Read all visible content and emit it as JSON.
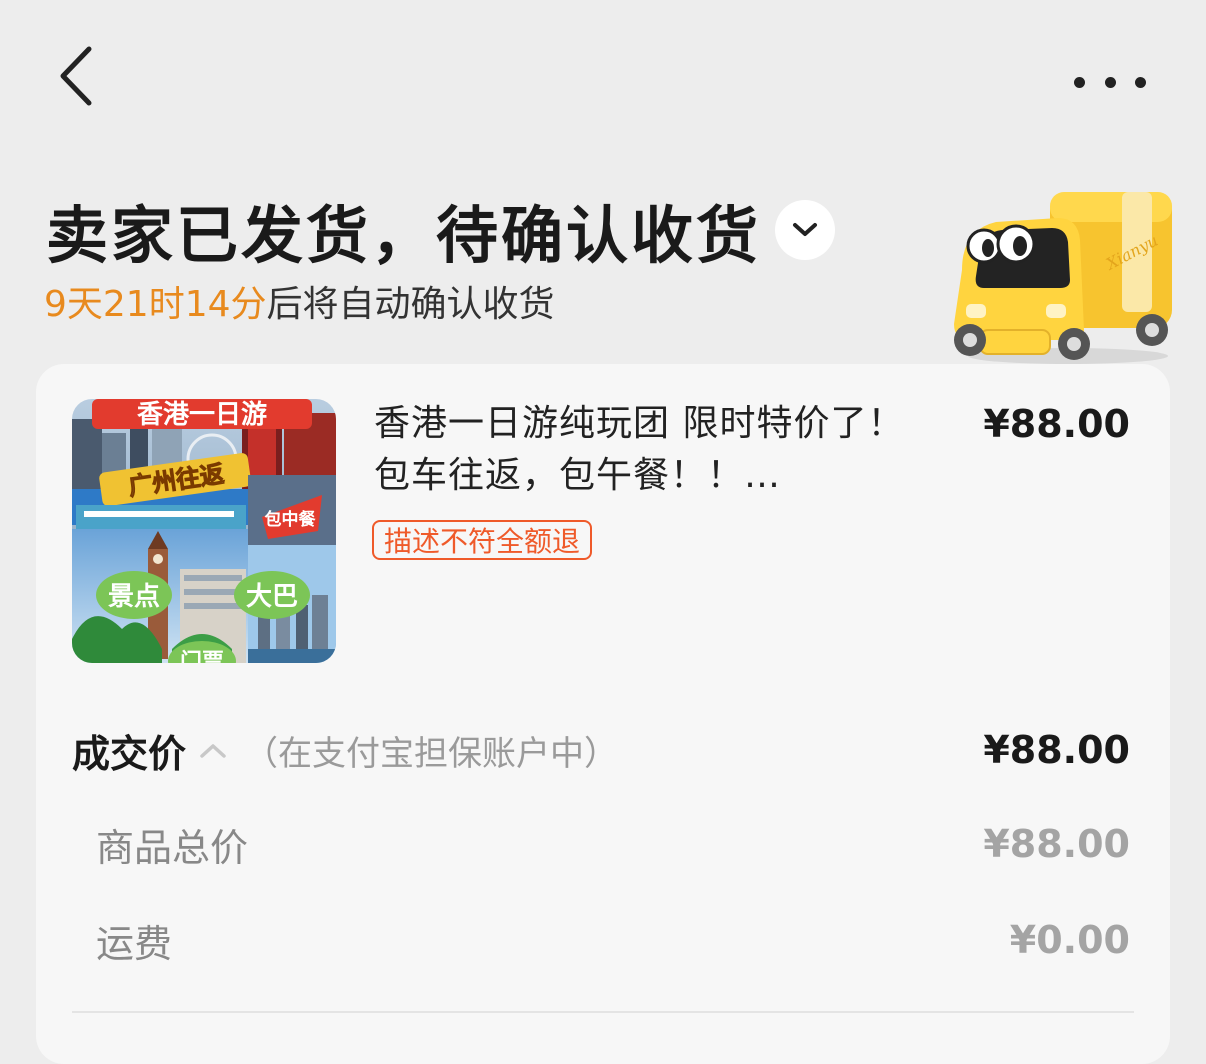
{
  "nav": {
    "back_icon": "chevron-left-icon",
    "more_icon": "more-dots-icon"
  },
  "status": {
    "title": "卖家已发货，待确认收货",
    "countdown": "9天21时14分",
    "auto_confirm_text": "后将自动确认收货",
    "expand_icon": "chevron-down-icon",
    "countdown_color": "#e88a1e"
  },
  "product": {
    "title": "香港一日游纯玩团 限时特价了！包车往返，包午餐！！…",
    "price": "¥88.00",
    "tag": "描述不符全额退",
    "tag_color": "#ef5a2a",
    "thumbnail_texts": {
      "banner": "香港一日游",
      "route": "广州往返",
      "lunch": "包中餐",
      "spot": "景点",
      "bus": "大巴",
      "ticket": "门票"
    }
  },
  "price_summary": {
    "deal_label": "成交价",
    "deal_note": "（在支付宝担保账户中）",
    "deal_price": "¥88.00",
    "rows": [
      {
        "label": "商品总价",
        "value": "¥88.00"
      },
      {
        "label": "运费",
        "value": "¥0.00"
      }
    ]
  },
  "illustration": {
    "truck_label": "Xianyu"
  }
}
